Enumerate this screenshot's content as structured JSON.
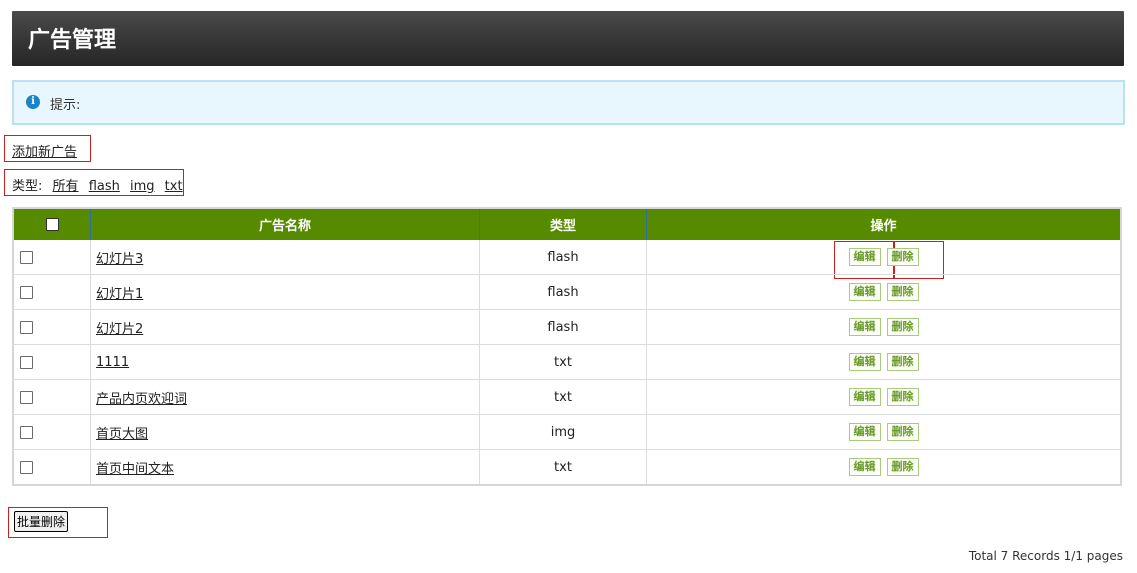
{
  "header": {
    "title": "广告管理"
  },
  "notice": {
    "icon": "info-icon",
    "text": "提示:"
  },
  "actions": {
    "add_label": "添加新广告"
  },
  "filter": {
    "label": "类型:",
    "options": [
      "所有",
      "flash",
      "img",
      "txt"
    ]
  },
  "table": {
    "columns": [
      "广告名称",
      "类型",
      "操作"
    ],
    "rows": [
      {
        "name": "幻灯片3",
        "type": "flash"
      },
      {
        "name": "幻灯片1",
        "type": "flash"
      },
      {
        "name": "幻灯片2",
        "type": "flash"
      },
      {
        "name": "1111",
        "type": "txt"
      },
      {
        "name": "产品内页欢迎词",
        "type": "txt"
      },
      {
        "name": "首页大图",
        "type": "img"
      },
      {
        "name": "首页中间文本",
        "type": "txt"
      }
    ],
    "edit_label": "编辑",
    "delete_label": "删除"
  },
  "batch": {
    "delete_label": "批量删除"
  },
  "pager": {
    "text": "Total 7 Records 1/1 pages"
  },
  "colors": {
    "header_bg": "#333333",
    "table_head": "#568b00",
    "notice_bg": "#e8f6fd",
    "highlight": "#cc1f1f"
  }
}
